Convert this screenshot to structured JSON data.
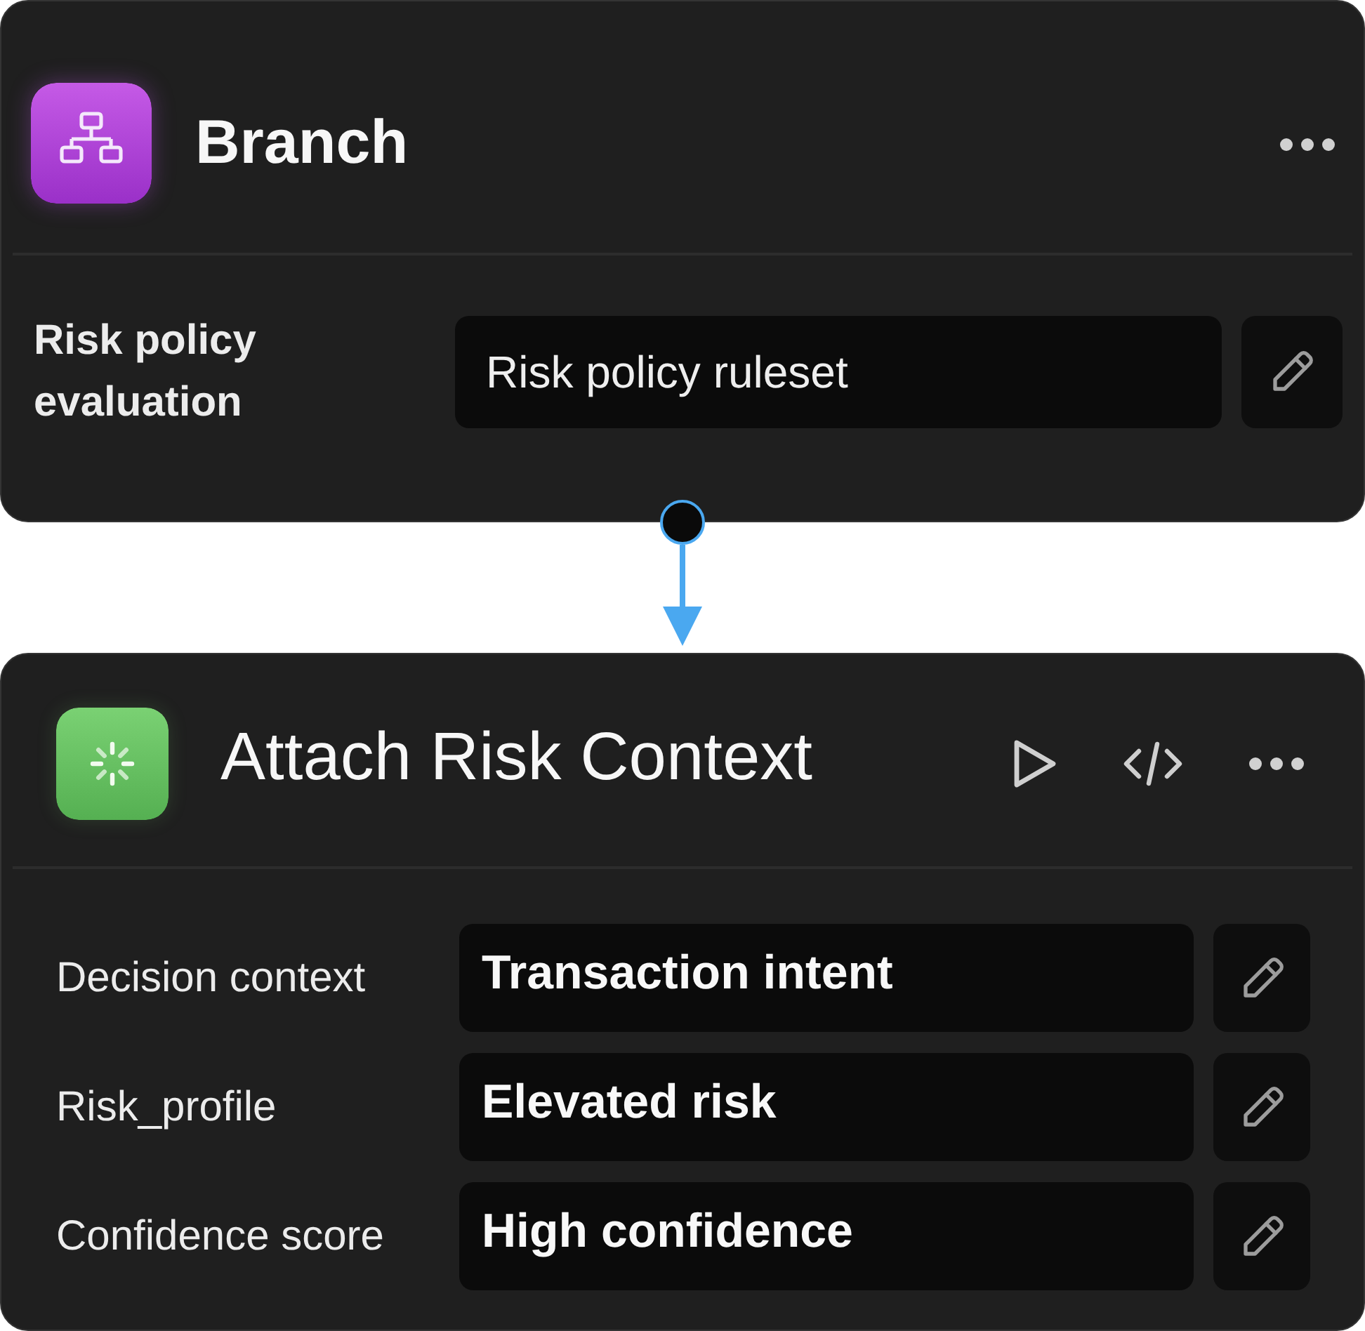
{
  "nodes": [
    {
      "kind": "branch",
      "title": "Branch",
      "fields": [
        {
          "label": "Risk policy evaluation",
          "value": "Risk policy ruleset"
        }
      ]
    },
    {
      "kind": "action",
      "title": "Attach Risk Context",
      "fields": [
        {
          "label": "Decision context",
          "value": "Transaction intent"
        },
        {
          "label": "Risk_profile",
          "value": "Elevated risk"
        },
        {
          "label": "Confidence score",
          "value": "High confidence"
        }
      ]
    }
  ]
}
